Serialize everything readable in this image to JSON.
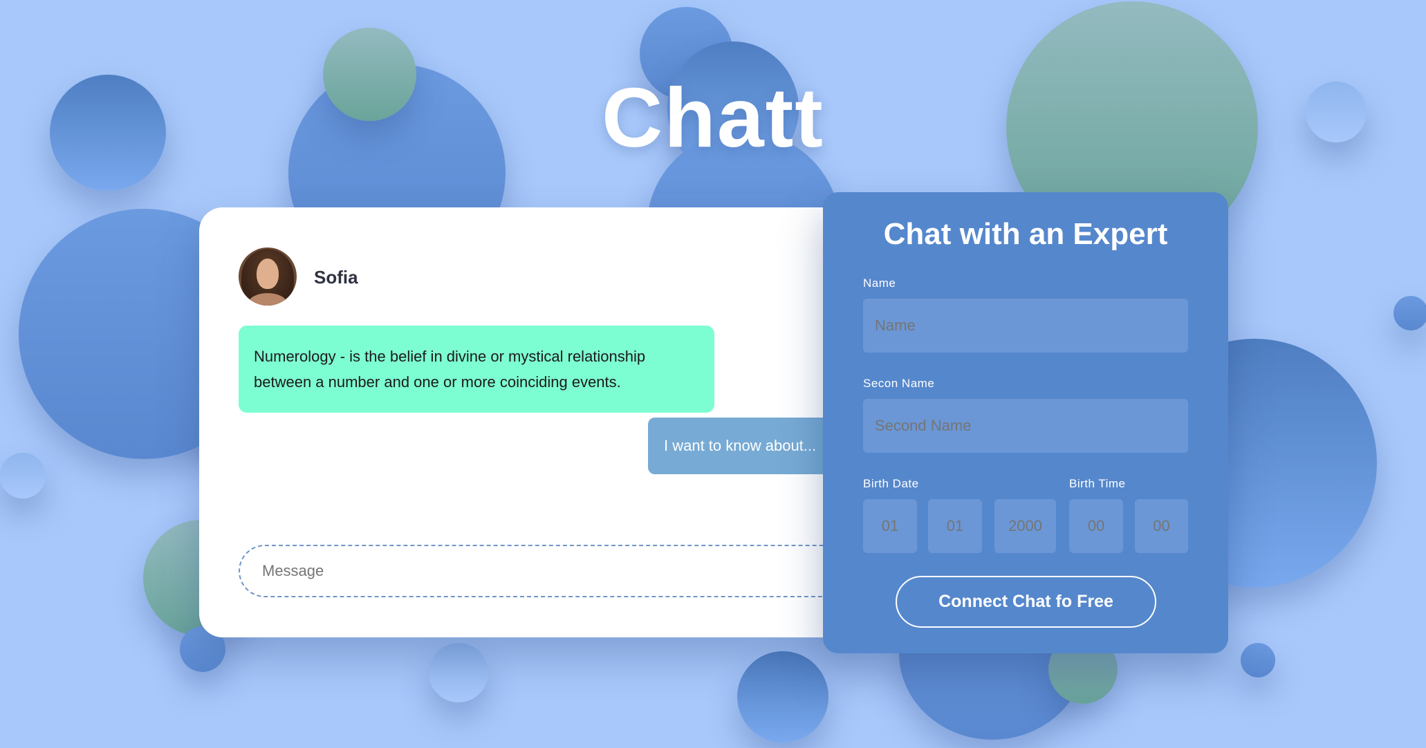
{
  "app": {
    "title": "Chatt"
  },
  "chat": {
    "user_name": "Sofia",
    "incoming_message": "Numerology - is the belief in divine or mystical relationship between a number and one or more coinciding events.",
    "outgoing_message": "I want to know about...",
    "message_placeholder": "Message"
  },
  "expert_form": {
    "title": "Chat with an Expert",
    "name_label": "Name",
    "name_placeholder": "Name",
    "second_name_label": "Secon Name",
    "second_name_placeholder": "Second Name",
    "birth_date_label": "Birth Date",
    "birth_time_label": "Birth Time",
    "birth_day": "01",
    "birth_month": "01",
    "birth_year": "2000",
    "birth_hour": "00",
    "birth_minute": "00",
    "connect_button": "Connect Chat fo Free"
  },
  "colors": {
    "background": "#a8c8fb",
    "form_panel": "#5587cc",
    "incoming_bubble": "#7dfdd2",
    "outgoing_bubble": "#77aad4"
  }
}
